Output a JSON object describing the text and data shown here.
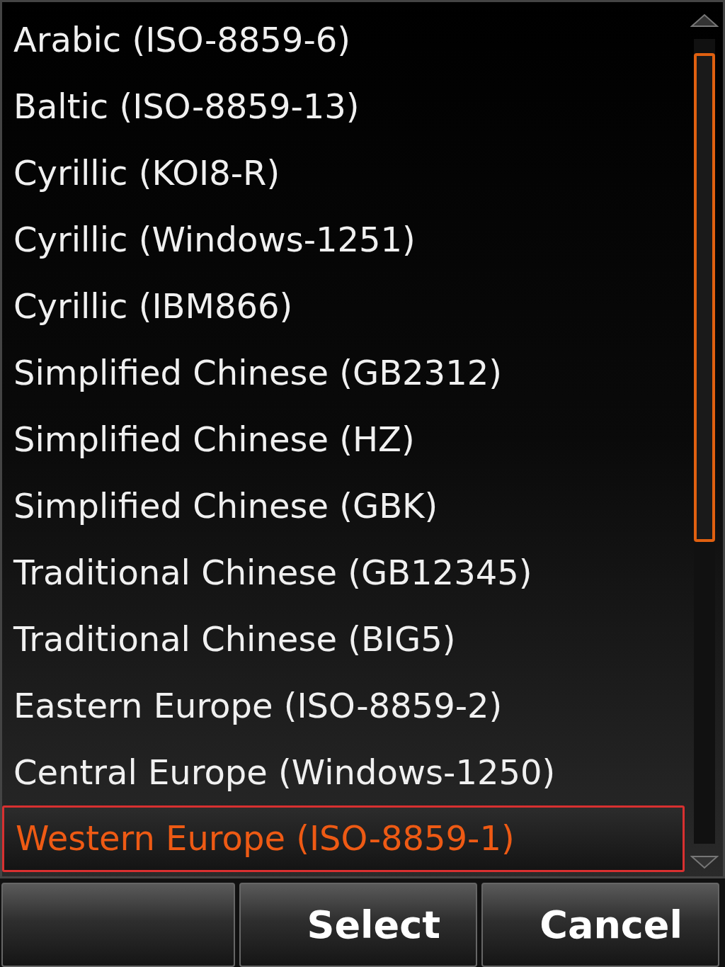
{
  "list": {
    "items": [
      {
        "label": "Arabic (ISO-8859-6)",
        "selected": false
      },
      {
        "label": "Baltic (ISO-8859-13)",
        "selected": false
      },
      {
        "label": "Cyrillic (KOI8-R)",
        "selected": false
      },
      {
        "label": "Cyrillic (Windows-1251)",
        "selected": false
      },
      {
        "label": "Cyrillic (IBM866)",
        "selected": false
      },
      {
        "label": "Simplified Chinese (GB2312)",
        "selected": false
      },
      {
        "label": "Simplified Chinese (HZ)",
        "selected": false
      },
      {
        "label": "Simplified Chinese (GBK)",
        "selected": false
      },
      {
        "label": "Traditional Chinese (GB12345)",
        "selected": false
      },
      {
        "label": "Traditional Chinese (BIG5)",
        "selected": false
      },
      {
        "label": "Eastern Europe (ISO-8859-2)",
        "selected": false
      },
      {
        "label": "Central Europe (Windows-1250)",
        "selected": false
      },
      {
        "label": "Western Europe (ISO-8859-1)",
        "selected": true
      }
    ]
  },
  "softkeys": [
    {
      "kind": "blank"
    },
    {
      "kind": "button",
      "label": "Select"
    },
    {
      "kind": "button",
      "label": "Cancel"
    }
  ]
}
